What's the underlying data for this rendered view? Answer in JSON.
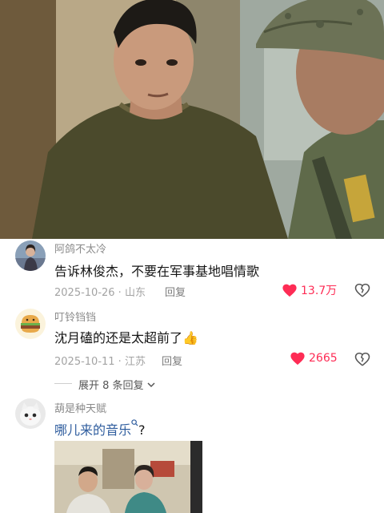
{
  "comments": [
    {
      "username": "阿鸽不太冷",
      "text": "告诉林俊杰，不要在军事基地唱情歌",
      "meta": "2025-10-26 · 山东",
      "reply_label": "回复",
      "likes": "13.7万",
      "avatar_icon": "girl-photo-avatar"
    },
    {
      "username": "叮铃铛铛",
      "text": "沈月磕的还是太超前了",
      "emoji": "👍",
      "meta": "2025-10-11 · 江苏",
      "reply_label": "回复",
      "likes": "2665",
      "avatar_icon": "burger-cartoon-avatar"
    },
    {
      "username": "葫是种天赋",
      "text": "哪儿来的音乐",
      "text_suffix": "?",
      "avatar_icon": "kitten-avatar"
    }
  ],
  "expand_replies": "展开 8 条回复",
  "colors": {
    "like_red": "#fe2c55",
    "link_blue": "#2f5d9e"
  },
  "icons": [
    "heart-icon",
    "broken-heart-icon",
    "chevron-down-icon",
    "search-icon"
  ]
}
